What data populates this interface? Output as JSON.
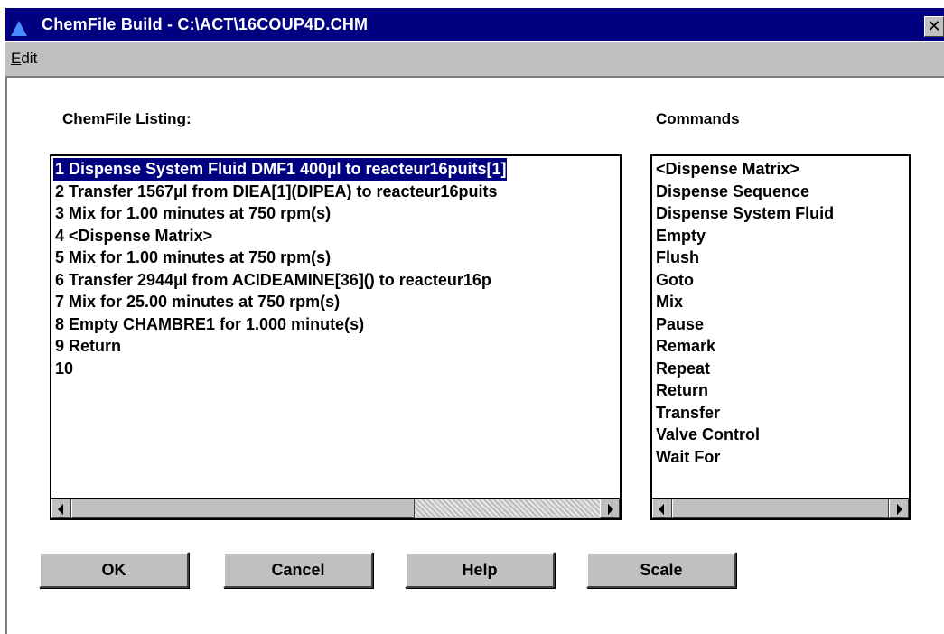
{
  "window": {
    "title": "ChemFile Build - C:\\ACT\\16COUP4D.CHM",
    "close_glyph": "✕"
  },
  "menu": {
    "edit_label": "Edit"
  },
  "listing": {
    "label": "ChemFile Listing:",
    "items": [
      "1 Dispense System Fluid DMF1  400µl to reacteur16puits[1]",
      "2 Transfer 1567µl from DIEA[1](DIPEA) to reacteur16puits",
      "3 Mix for 1.00 minutes  at 750 rpm(s)",
      "4 <Dispense Matrix>",
      "5 Mix for 1.00 minutes  at 750 rpm(s)",
      "6 Transfer 2944µl from ACIDEAMINE[36]() to reacteur16p",
      "7 Mix for 25.00 minutes  at 750 rpm(s)",
      "8 Empty CHAMBRE1 for 1.000 minute(s)",
      "9 Return",
      "10"
    ],
    "selected_index": 0
  },
  "commands": {
    "label": "Commands",
    "items": [
      "<Dispense Matrix>",
      "Dispense Sequence",
      "Dispense System Fluid",
      "Empty",
      "Flush",
      "Goto",
      "Mix",
      "Pause",
      "Remark",
      "Repeat",
      "Return",
      "Transfer",
      "Valve Control",
      "Wait For"
    ]
  },
  "buttons": {
    "ok": "OK",
    "cancel": "Cancel",
    "help": "Help",
    "scale": "Scale"
  },
  "colors": {
    "titlebar": "#000080",
    "selection": "#000080",
    "button_face": "#c0c0c0"
  }
}
